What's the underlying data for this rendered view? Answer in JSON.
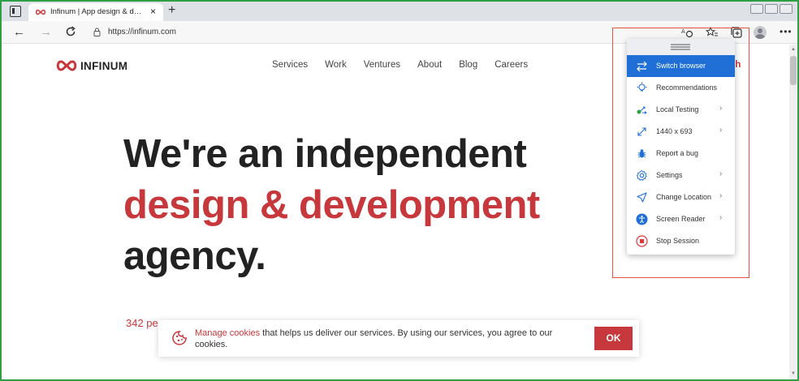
{
  "browser": {
    "tab_title": "Infinum | App design & development",
    "tab_close": "×",
    "new_tab": "+",
    "url": "https://infinum.com"
  },
  "site": {
    "logo_text": "INFINUM",
    "nav": [
      "Services",
      "Work",
      "Ventures",
      "About",
      "Blog",
      "Careers"
    ],
    "nav_partial": "ch",
    "hero_line1": "We're an independent",
    "hero_line2": "design & development",
    "hero_line3": "agency.",
    "stat_partial": "342 pe",
    "brand_red": "#c6383b"
  },
  "cookie_banner": {
    "link_text": "Manage cookies",
    "body_text": " that helps us deliver our services. By using our services, you agree to our cookies.",
    "ok_label": "OK"
  },
  "popup_menu": {
    "accent": "#1f6fd6",
    "items": [
      {
        "label": "Switch browser",
        "icon": "switch-icon",
        "chevron": ""
      },
      {
        "label": "Recommendations",
        "icon": "lightbulb-icon",
        "chevron": ""
      },
      {
        "label": "Local Testing",
        "icon": "local-testing-icon",
        "chevron": "›"
      },
      {
        "label": "1440 x 693",
        "icon": "resize-icon",
        "chevron": "›"
      },
      {
        "label": "Report a bug",
        "icon": "bug-icon",
        "chevron": ""
      },
      {
        "label": "Settings",
        "icon": "gear-icon",
        "chevron": "›"
      },
      {
        "label": "Change Location",
        "icon": "location-arrow-icon",
        "chevron": "›"
      },
      {
        "label": "Screen Reader",
        "icon": "accessibility-icon",
        "chevron": "›"
      },
      {
        "label": "Stop Session",
        "icon": "stop-icon",
        "chevron": ""
      }
    ]
  }
}
